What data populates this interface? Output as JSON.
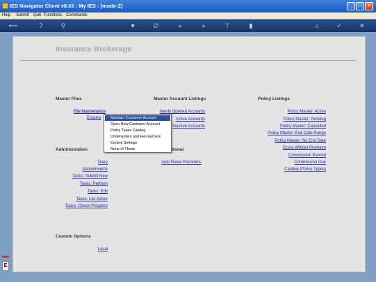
{
  "window": {
    "title": "IES Navigator Client v8.03 : My IES :       [mode-Z]"
  },
  "menubar": [
    "Help",
    "Submit",
    "Quit",
    "Functions",
    "Commands"
  ],
  "toolbar": {
    "icons": [
      "back-icon",
      "help-icon",
      "search-icon",
      "heart-icon",
      "link-icon",
      "first-page-icon",
      "last-page-icon",
      "pin-icon",
      "copy-icon",
      "home-icon",
      "ok-icon",
      "close-icon"
    ]
  },
  "page": {
    "title": "Insurance Brokerage"
  },
  "master_files": {
    "heading": "Master Files",
    "links": [
      "File Maintenance",
      "Enquiry"
    ]
  },
  "administration": {
    "heading": "Administration",
    "links": [
      "Diary",
      "Appointments",
      "Tasks: Submit New",
      "Tasks: Perform",
      "Tasks: Edit",
      "Tasks: List Active",
      "Tasks: Check Progress"
    ]
  },
  "custom_options": {
    "heading": "Custom Options",
    "links": [
      "Local"
    ]
  },
  "master_listings": {
    "heading": "Master Account Listings",
    "links": [
      "Newly Opened Accounts",
      "Active Accounts",
      "Inactive Accounts"
    ]
  },
  "optional": {
    "heading_partial": "tional",
    "links": [
      "Auto Raise Premiums"
    ]
  },
  "policy_listings": {
    "heading": "Policy Listings",
    "links": [
      "Policy Master: Active",
      "Policy Master: Pending",
      "Policy Master: Cancelled",
      "Policy Master: End Date Range",
      "Policy Master: No End Date",
      "Gross Written Premium",
      "Commission Earned",
      "Commission Due",
      "Catalog (Policy Types)"
    ]
  },
  "popup_menu": {
    "items": [
      "Maintain Customer Account",
      "Open New Customer Account",
      "Policy Types Catalog",
      "Underwriters and Fee Earners",
      "Control Settings",
      "None of These"
    ],
    "highlighted_index": 0
  },
  "side_glyph": "E"
}
